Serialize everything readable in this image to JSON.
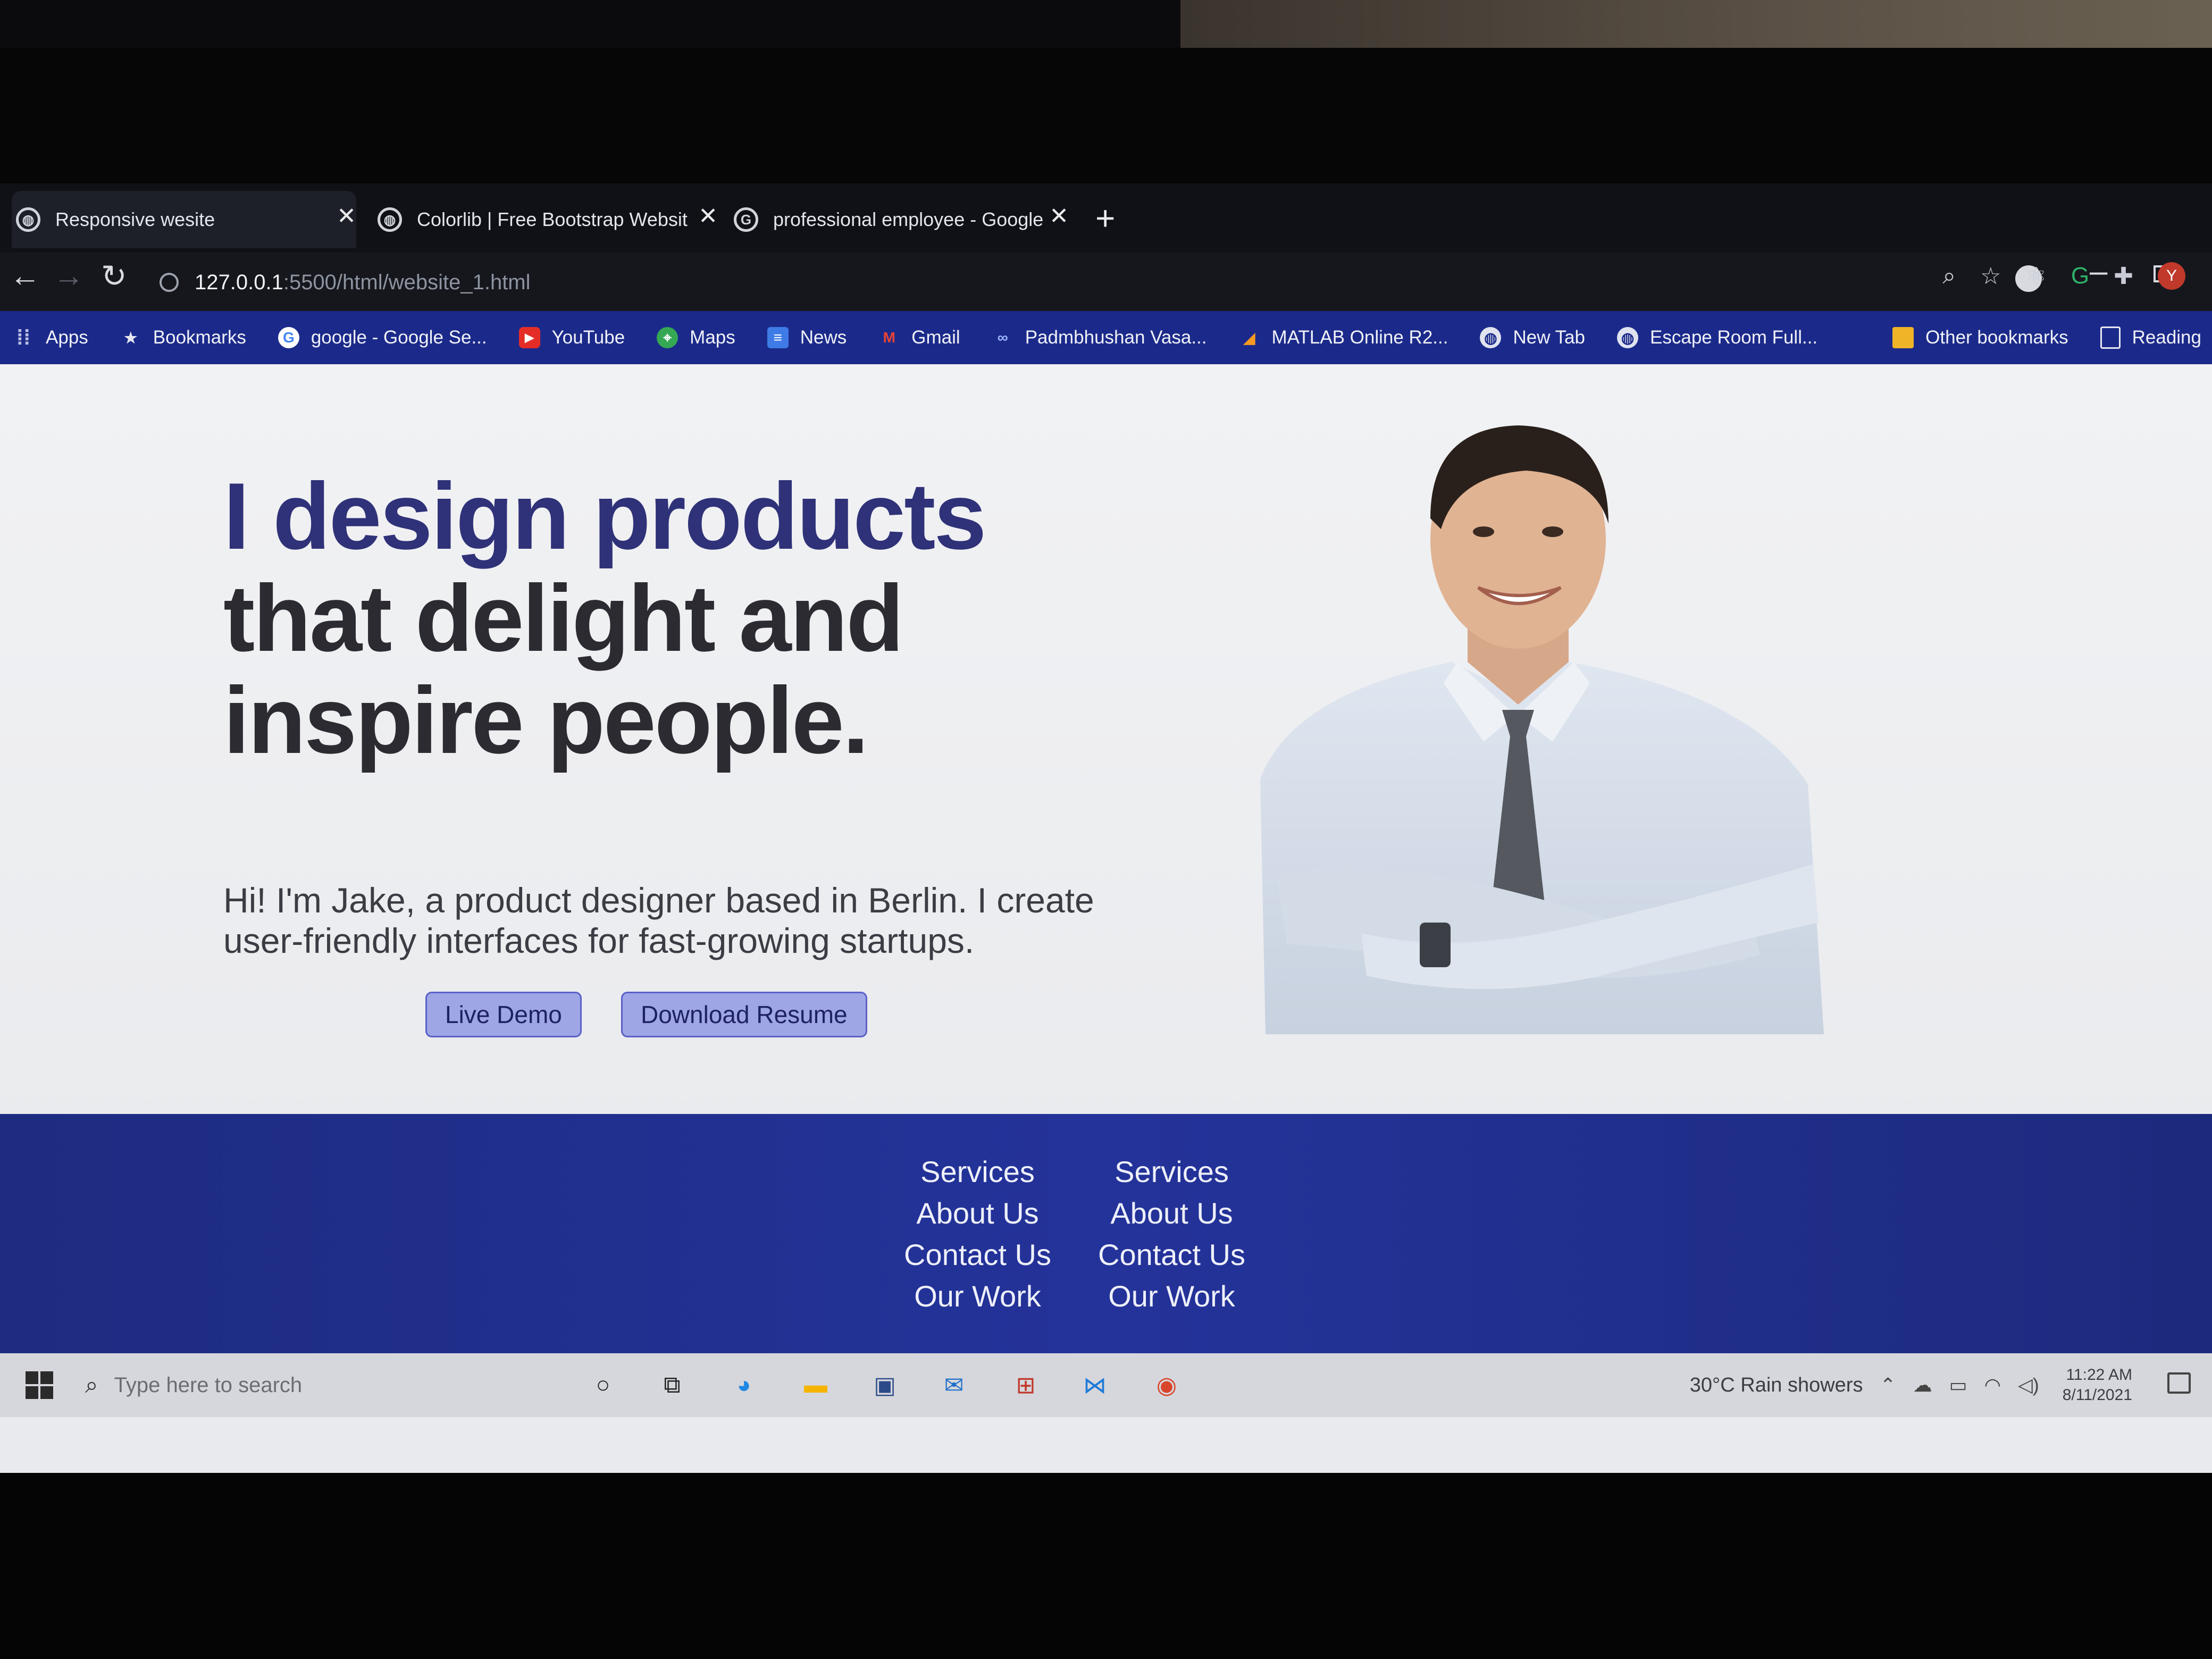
{
  "browser": {
    "tabs": [
      {
        "title": "Responsive wesite",
        "favicon": "globe-icon"
      },
      {
        "title": "Colorlib | Free Bootstrap Websit",
        "favicon": "globe-icon"
      },
      {
        "title": "professional employee - Google",
        "favicon": "google-icon"
      }
    ],
    "url_host": "127.0.0.1",
    "url_path": ":5500/html/website_1.html",
    "bookmarks": [
      {
        "label": "Apps",
        "icon": "apps-icon"
      },
      {
        "label": "Bookmarks",
        "icon": "star-icon"
      },
      {
        "label": "google - Google Se...",
        "icon": "google-icon"
      },
      {
        "label": "YouTube",
        "icon": "youtube-icon"
      },
      {
        "label": "Maps",
        "icon": "maps-icon"
      },
      {
        "label": "News",
        "icon": "news-icon"
      },
      {
        "label": "Gmail",
        "icon": "gmail-icon"
      },
      {
        "label": "Padmbhushan Vasa...",
        "icon": "link-icon"
      },
      {
        "label": "MATLAB Online R2...",
        "icon": "matlab-icon"
      },
      {
        "label": "New Tab",
        "icon": "globe-icon"
      },
      {
        "label": "Escape Room Full...",
        "icon": "globe-icon"
      }
    ],
    "other_bookmarks": "Other bookmarks",
    "reading_list": "Reading",
    "profile_initial": "Y"
  },
  "page": {
    "hero_title_accent": "I design products",
    "hero_title_rest_1": "that delight and",
    "hero_title_rest_2": "inspire people.",
    "hero_intro": "Hi! I'm Jake, a product designer based in Berlin. I create user-friendly interfaces for fast-growing startups.",
    "live_demo_label": "Live Demo",
    "download_resume_label": "Download Resume",
    "footer_columns": [
      [
        "Services",
        "About Us",
        "Contact Us",
        "Our Work"
      ],
      [
        "Services",
        "About Us",
        "Contact Us",
        "Our Work"
      ]
    ]
  },
  "taskbar": {
    "search_placeholder": "Type here to search",
    "weather": "30°C  Rain showers",
    "time": "11:22 AM",
    "date": "8/11/2021"
  },
  "colors": {
    "bookmarks_bar": "#1b2a8a",
    "footer": "#24339a",
    "hero_accent": "#2f3278",
    "button_fill": "#9ea6e6"
  }
}
